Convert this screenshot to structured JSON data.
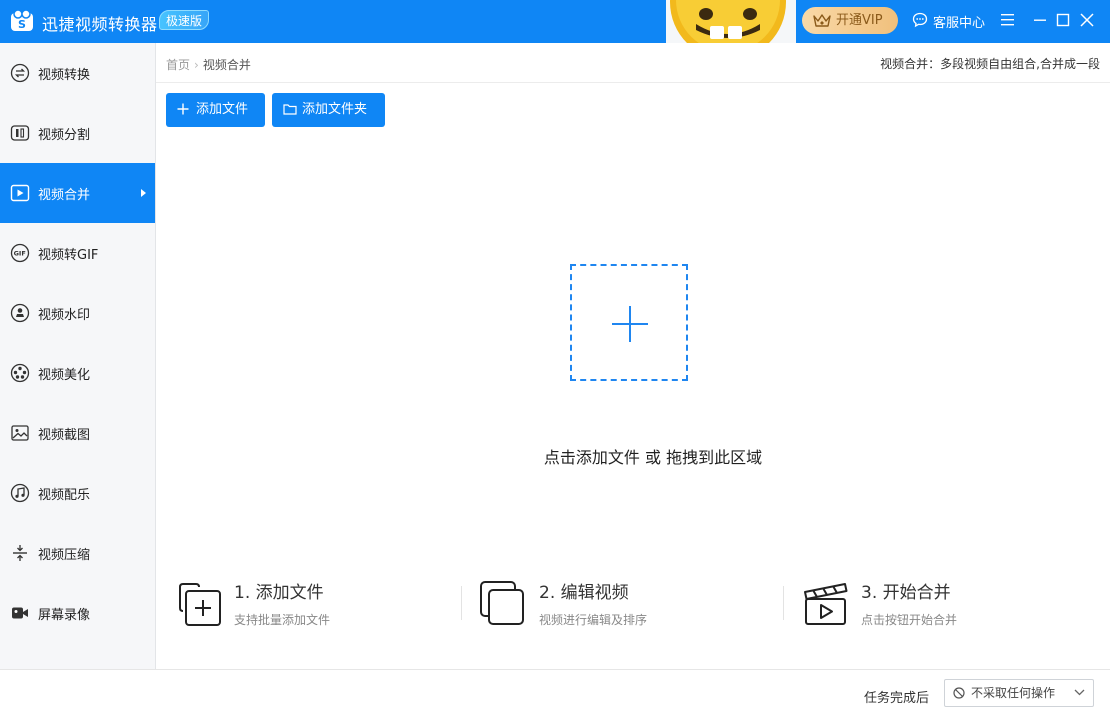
{
  "app": {
    "title": "迅捷视频转换器",
    "edition": "极速版",
    "vip_label": "开通VIP",
    "service_label": "客服中心",
    "colors": {
      "primary": "#0f86f5",
      "vip": "#f0c07c"
    }
  },
  "sidebar": {
    "items": [
      {
        "label": "视频转换",
        "icon": "convert-icon"
      },
      {
        "label": "视频分割",
        "icon": "split-icon"
      },
      {
        "label": "视频合并",
        "icon": "merge-icon",
        "active": true
      },
      {
        "label": "视频转GIF",
        "icon": "gif-icon"
      },
      {
        "label": "视频水印",
        "icon": "watermark-icon"
      },
      {
        "label": "视频美化",
        "icon": "beautify-icon"
      },
      {
        "label": "视频截图",
        "icon": "screenshot-icon"
      },
      {
        "label": "视频配乐",
        "icon": "music-icon"
      },
      {
        "label": "视频压缩",
        "icon": "compress-icon"
      },
      {
        "label": "屏幕录像",
        "icon": "record-icon"
      }
    ]
  },
  "breadcrumb": {
    "home": "首页",
    "current": "视频合并"
  },
  "header": {
    "description": "视频合并：多段视频自由组合,合并成一段"
  },
  "toolbar": {
    "add_file": "添加文件",
    "add_folder": "添加文件夹"
  },
  "dropzone": {
    "hint": "点击添加文件 或 拖拽到此区域"
  },
  "steps": [
    {
      "title": "1. 添加文件",
      "desc": "支持批量添加文件",
      "icon": "add-files-icon"
    },
    {
      "title": "2. 编辑视频",
      "desc": "视频进行编辑及排序",
      "icon": "edit-video-icon"
    },
    {
      "title": "3. 开始合并",
      "desc": "点击按钮开始合并",
      "icon": "clapper-icon"
    }
  ],
  "footer": {
    "after_task_label": "任务完成后",
    "after_task_value": "不采取任何操作"
  }
}
